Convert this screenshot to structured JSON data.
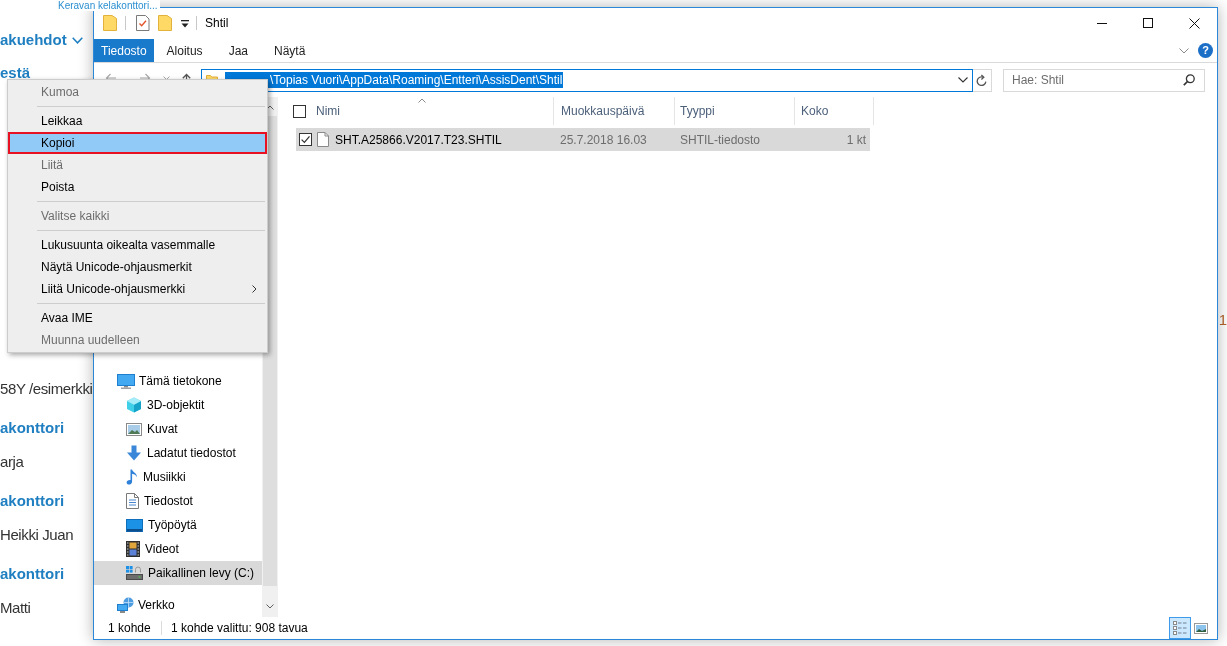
{
  "background_page": {
    "link": "Keravan kelakonttori...",
    "sections": [
      {
        "items": [
          {
            "kind": "dropdown",
            "text": "akuehdot"
          },
          {
            "kind": "heading",
            "text": "estä"
          }
        ]
      },
      {
        "items": [
          {
            "kind": "text",
            "text": "58Y /esimerkki"
          },
          {
            "kind": "heading",
            "text": "akonttori"
          },
          {
            "kind": "text",
            "text": "arja"
          },
          {
            "kind": "heading",
            "text": "akonttori"
          },
          {
            "kind": "text",
            "text": "Heikki Juan"
          },
          {
            "kind": "heading",
            "text": "akonttori"
          },
          {
            "kind": "text",
            "text": "Matti"
          }
        ]
      }
    ],
    "edge_text": "1"
  },
  "window": {
    "title": "Shtil"
  },
  "ribbon": {
    "tabs": [
      {
        "kind": "file",
        "label": "Tiedosto",
        "selected": false
      },
      {
        "kind": "tab",
        "label": "Aloitus",
        "selected": false
      },
      {
        "kind": "tab",
        "label": "Jaa",
        "selected": false
      },
      {
        "kind": "tab",
        "label": "Näytä",
        "selected": false
      }
    ],
    "help": "?"
  },
  "address_bar": {
    "path": "\\Topias Vuori\\AppData\\Roaming\\Entteri\\AssisDent\\Shtil",
    "path_selected": true
  },
  "search": {
    "placeholder": "Hae: Shtil"
  },
  "navigation": {
    "items": [
      {
        "label": "Tämä tietokone",
        "selected": false,
        "children": [
          {
            "label": "3D-objektit",
            "selected": false
          },
          {
            "label": "Kuvat",
            "selected": false
          },
          {
            "label": "Ladatut tiedostot",
            "selected": false
          },
          {
            "label": "Musiikki",
            "selected": false
          },
          {
            "label": "Tiedostot",
            "selected": false
          },
          {
            "label": "Työpöytä",
            "selected": false
          },
          {
            "label": "Videot",
            "selected": false
          },
          {
            "label": "Paikallinen levy (C:)",
            "selected": true
          }
        ]
      },
      {
        "label": "Verkko",
        "selected": false
      }
    ]
  },
  "file_list": {
    "select_all_checked": false,
    "columns": [
      {
        "label": "Nimi",
        "sorted": true
      },
      {
        "label": "Muokkauspäivä",
        "sorted": false
      },
      {
        "label": "Tyyppi",
        "sorted": false
      },
      {
        "label": "Koko",
        "sorted": false
      }
    ],
    "rows": [
      {
        "name": "SHT.A25866.V2017.T23.SHTIL",
        "modified": "25.7.2018 16.03",
        "type": "SHTIL-tiedosto",
        "size": "1 kt",
        "selected": true,
        "checked": true
      }
    ]
  },
  "status_bar": {
    "item_count": "1 kohde",
    "selection": "1 kohde valittu: 908 tavua",
    "views": [
      {
        "selected": true
      },
      {
        "selected": false
      }
    ]
  },
  "context_menu": {
    "items": [
      {
        "kind": "item",
        "label": "Kumoa",
        "disabled": true,
        "selected": false,
        "outlined": false,
        "submenu": false
      },
      {
        "kind": "separator"
      },
      {
        "kind": "item",
        "label": "Leikkaa",
        "disabled": false,
        "selected": false,
        "outlined": false,
        "submenu": false
      },
      {
        "kind": "item",
        "label": "Kopioi",
        "disabled": false,
        "selected": true,
        "outlined": true,
        "submenu": false
      },
      {
        "kind": "item",
        "label": "Liitä",
        "disabled": true,
        "selected": false,
        "outlined": false,
        "submenu": false
      },
      {
        "kind": "item",
        "label": "Poista",
        "disabled": false,
        "selected": false,
        "outlined": false,
        "submenu": false
      },
      {
        "kind": "separator"
      },
      {
        "kind": "item",
        "label": "Valitse kaikki",
        "disabled": true,
        "selected": false,
        "outlined": false,
        "submenu": false
      },
      {
        "kind": "separator"
      },
      {
        "kind": "item",
        "label": "Lukusuunta oikealta vasemmalle",
        "disabled": false,
        "selected": false,
        "outlined": false,
        "submenu": false
      },
      {
        "kind": "item",
        "label": "Näytä Unicode-ohjausmerkit",
        "disabled": false,
        "selected": false,
        "outlined": false,
        "submenu": false
      },
      {
        "kind": "item",
        "label": "Liitä Unicode-ohjausmerkki",
        "disabled": false,
        "selected": false,
        "outlined": false,
        "submenu": true
      },
      {
        "kind": "separator"
      },
      {
        "kind": "item",
        "label": "Avaa IME",
        "disabled": false,
        "selected": false,
        "outlined": false,
        "submenu": false
      },
      {
        "kind": "item",
        "label": "Muunna uudelleen",
        "disabled": true,
        "selected": false,
        "outlined": false,
        "submenu": false
      }
    ]
  }
}
